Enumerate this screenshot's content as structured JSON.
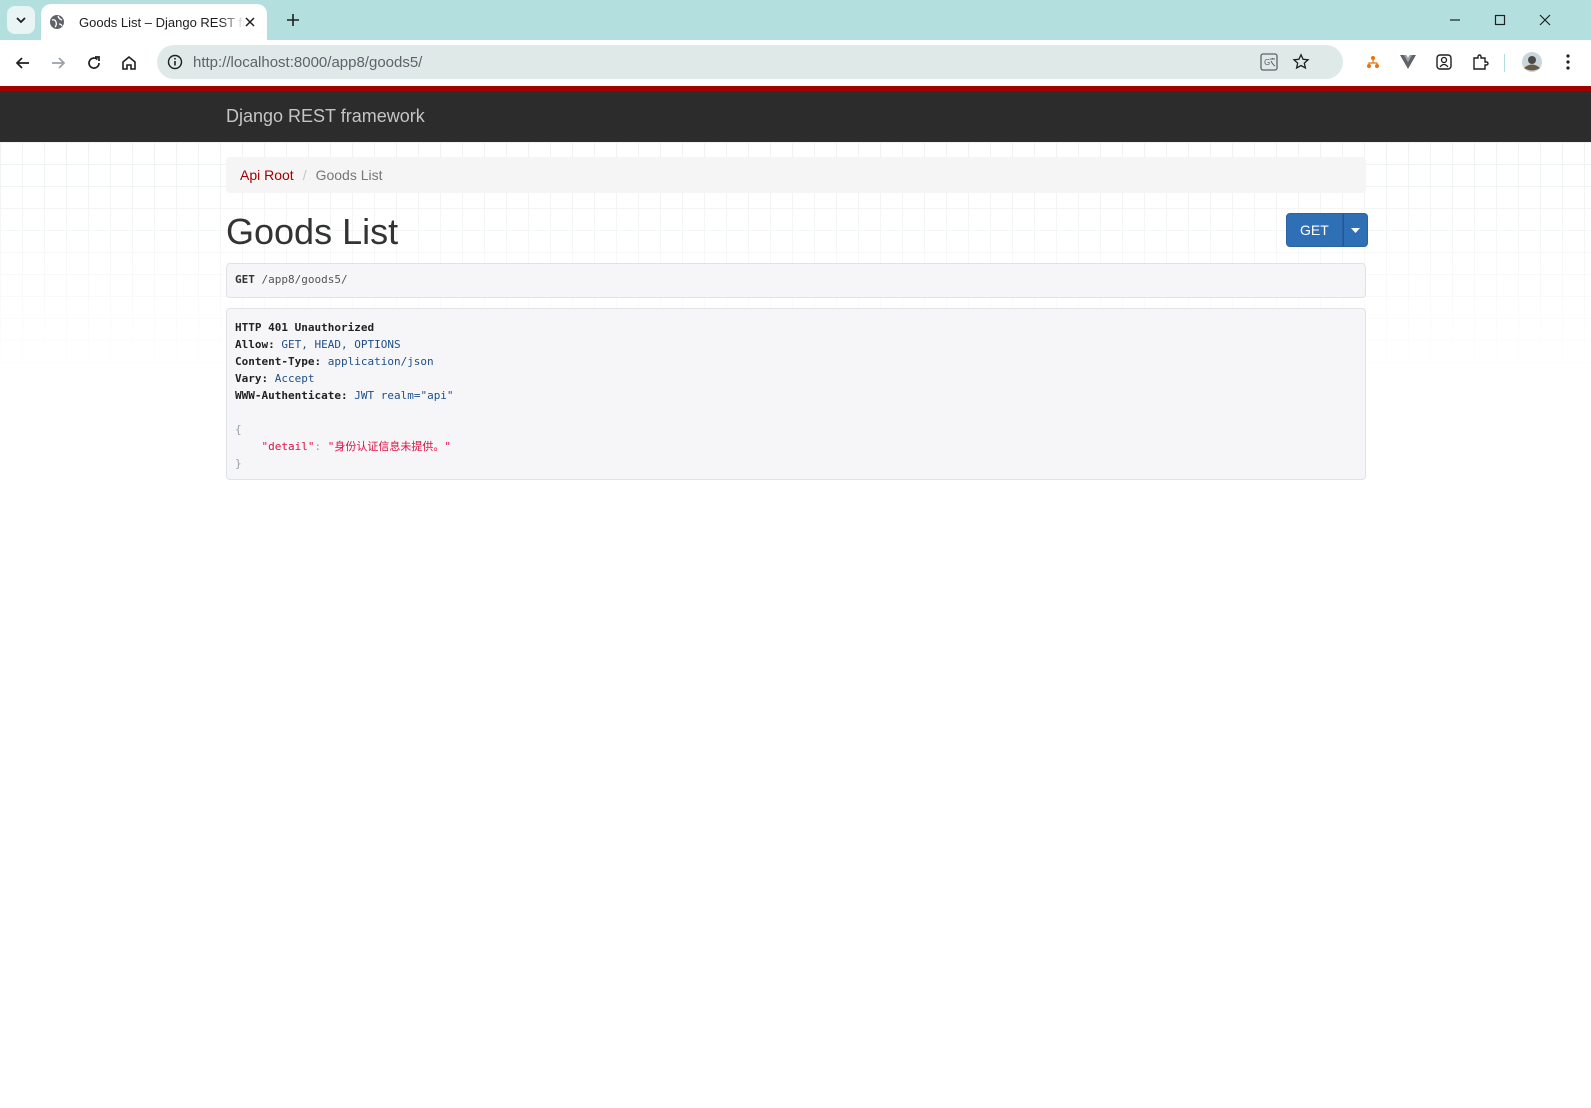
{
  "browser": {
    "tab_title": "Goods List – Django REST framework",
    "url_host": "http://localhost",
    "url_rest": ":8000/app8/goods5/"
  },
  "page": {
    "brand": "Django REST framework",
    "breadcrumb": {
      "root_label": "Api Root",
      "separator": "/",
      "current_label": "Goods List"
    },
    "title": "Goods List",
    "get_button_label": "GET",
    "request": {
      "method": "GET",
      "path": "/app8/goods5/"
    },
    "response": {
      "status_line": "HTTP 401 Unauthorized",
      "headers": [
        {
          "key": "Allow:",
          "value": "GET, HEAD, OPTIONS"
        },
        {
          "key": "Content-Type:",
          "value": "application/json"
        },
        {
          "key": "Vary:",
          "value": "Accept"
        },
        {
          "key": "WWW-Authenticate:",
          "value": "JWT realm=\"api\""
        }
      ],
      "body_open": "{",
      "body_key": "\"detail\"",
      "body_colon": ": ",
      "body_value": "\"身份认证信息未提供。\"",
      "body_close": "}"
    }
  },
  "colors": {
    "tabbar_bg": "#b3e0df",
    "navbar_bg": "#2c2c2c",
    "navbar_accent": "#a30000",
    "get_button": "#2e6fb5",
    "link": "#a30000"
  }
}
